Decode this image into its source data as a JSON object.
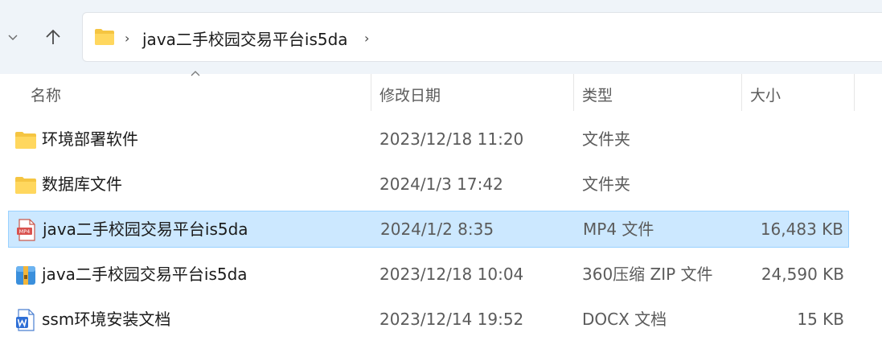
{
  "address": {
    "crumb": "java二手校园交易平台is5da",
    "sep1": "›",
    "sep2": "›"
  },
  "columns": {
    "name": "名称",
    "date": "修改日期",
    "type": "类型",
    "size": "大小"
  },
  "files": [
    {
      "name": "环境部署软件",
      "date": "2023/12/18 11:20",
      "type": "文件夹",
      "size": "",
      "icon": "folder-icon",
      "selected": false
    },
    {
      "name": "数据库文件",
      "date": "2024/1/3 17:42",
      "type": "文件夹",
      "size": "",
      "icon": "folder-icon",
      "selected": false
    },
    {
      "name": "java二手校园交易平台is5da",
      "date": "2024/1/2 8:35",
      "type": "MP4 文件",
      "size": "16,483 KB",
      "icon": "mp4-file-icon",
      "selected": true
    },
    {
      "name": "java二手校园交易平台is5da",
      "date": "2023/12/18 10:04",
      "type": "360压缩 ZIP 文件",
      "size": "24,590 KB",
      "icon": "zip-archive-icon",
      "selected": false
    },
    {
      "name": "ssm环境安装文档",
      "date": "2023/12/14 19:52",
      "type": "DOCX 文档",
      "size": "15 KB",
      "icon": "docx-file-icon",
      "selected": false
    }
  ],
  "colors": {
    "selection": "#cce8ff",
    "selection_border": "#99d1ff",
    "folder": "#f5c542",
    "navbar": "#eff4f9"
  }
}
